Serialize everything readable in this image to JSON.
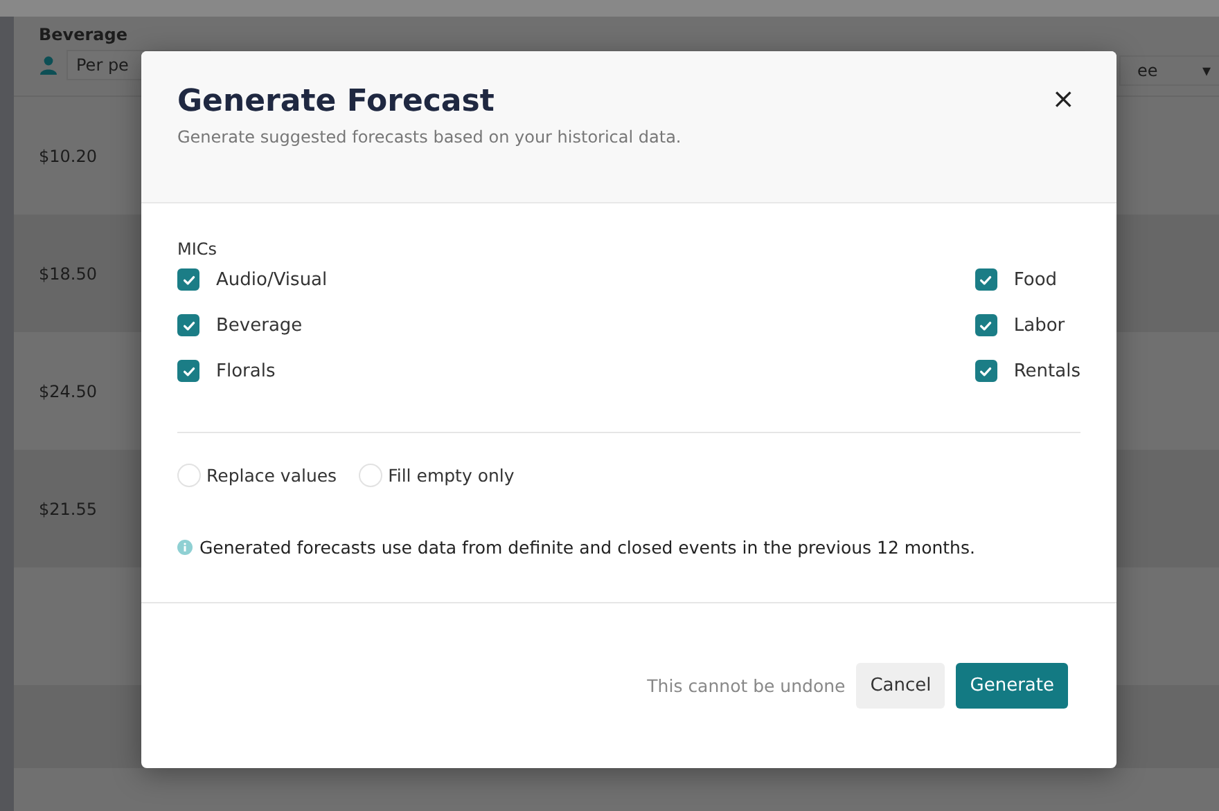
{
  "background": {
    "column_title": "Beverage",
    "unit_select": "Per pe",
    "column_2_select": "ee",
    "column_2_caret": "▾",
    "rows": [
      "$10.20",
      "$18.50",
      "$24.50",
      "$21.55"
    ]
  },
  "dialog": {
    "title": "Generate Forecast",
    "subtitle": "Generate suggested forecasts based on your historical data.",
    "close": "×",
    "group_label": "MICs",
    "mics": [
      {
        "label": "Audio/Visual",
        "checked": true
      },
      {
        "label": "Beverage",
        "checked": true
      },
      {
        "label": "Florals",
        "checked": true
      },
      {
        "label": "Food",
        "checked": true
      },
      {
        "label": "Labor",
        "checked": true
      },
      {
        "label": "Rentals",
        "checked": true
      }
    ],
    "modes": [
      {
        "label": "Replace values",
        "selected": false
      },
      {
        "label": "Fill empty only",
        "selected": false
      }
    ],
    "info": "Generated forecasts use data from definite and closed events in the previous 12 months.",
    "warning": "This cannot be undone",
    "buttons": [
      {
        "label": "Cancel",
        "kind": "secondary"
      },
      {
        "label": "Generate",
        "kind": "primary"
      }
    ]
  }
}
